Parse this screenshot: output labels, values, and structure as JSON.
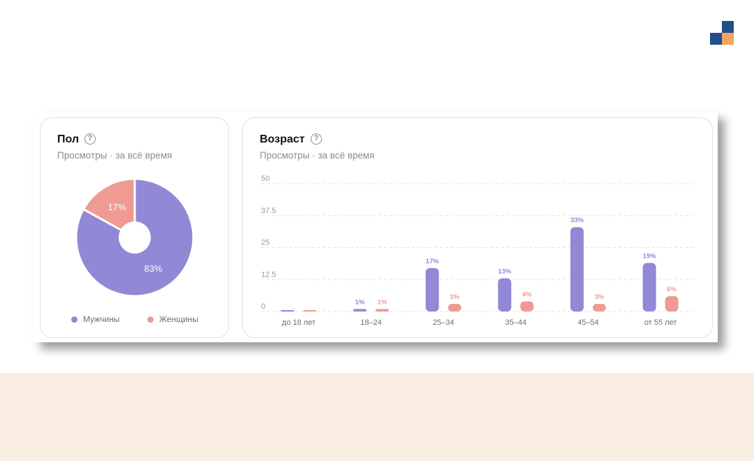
{
  "colors": {
    "male": "#9189d5",
    "female": "#ef9b94",
    "logo_dark": "#1f4f8c",
    "logo_orange": "#f0a560",
    "bottom_band": "#faeee2"
  },
  "gender_card": {
    "title": "Пол",
    "subtitle": "Просмотры · за всё время",
    "help_icon": "question-circle-icon",
    "legend": [
      "Мужчины",
      "Женщины"
    ]
  },
  "age_card": {
    "title": "Возраст",
    "subtitle": "Просмотры · за всё время",
    "help_icon": "question-circle-icon"
  },
  "chart_data": [
    {
      "type": "pie",
      "donut": true,
      "categories": [
        "Мужчины",
        "Женщины"
      ],
      "values": [
        83,
        17
      ],
      "labels": [
        "83%",
        "17%"
      ],
      "legend_position": "bottom"
    },
    {
      "type": "bar",
      "categories": [
        "до 18 лет",
        "18–24",
        "25–34",
        "35–44",
        "45–54",
        "от 55 лет"
      ],
      "series": [
        {
          "name": "Мужчины",
          "values": [
            0.5,
            1,
            17,
            13,
            33,
            19
          ],
          "labels": [
            "",
            "1%",
            "17%",
            "13%",
            "33%",
            "19%"
          ]
        },
        {
          "name": "Женщины",
          "values": [
            0.5,
            1,
            3,
            4,
            3,
            6
          ],
          "labels": [
            "",
            "1%",
            "3%",
            "4%",
            "3%",
            "6%"
          ]
        }
      ],
      "ylim": [
        0,
        50
      ],
      "yticks": [
        "0",
        "12.5",
        "25",
        "37.5",
        "50"
      ],
      "grid": true
    }
  ]
}
